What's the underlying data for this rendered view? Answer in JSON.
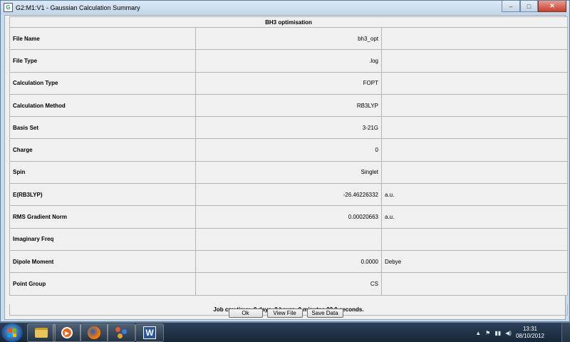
{
  "window": {
    "title": "G2:M1:V1 - Gaussian Calculation Summary",
    "icon_label": "G",
    "controls": {
      "minimize": "–",
      "maximize": "□",
      "close": "✕"
    }
  },
  "summary": {
    "header": "BH3 optimisation",
    "rows": [
      {
        "label": "File Name",
        "value": "bh3_opt",
        "unit": ""
      },
      {
        "label": "File Type",
        "value": ".log",
        "unit": ""
      },
      {
        "label": "Calculation Type",
        "value": "FOPT",
        "unit": ""
      },
      {
        "label": "Calculation Method",
        "value": "RB3LYP",
        "unit": ""
      },
      {
        "label": "Basis Set",
        "value": "3-21G",
        "unit": ""
      },
      {
        "label": "Charge",
        "value": "0",
        "unit": ""
      },
      {
        "label": "Spin",
        "value": "Singlet",
        "unit": ""
      },
      {
        "label": "E(RB3LYP)",
        "value": "-26.46226332",
        "unit": "a.u."
      },
      {
        "label": "RMS Gradient Norm",
        "value": "0.00020663",
        "unit": "a.u."
      },
      {
        "label": "Imaginary Freq",
        "value": "",
        "unit": ""
      },
      {
        "label": "Dipole Moment",
        "value": "0.0000",
        "unit": "Debye"
      },
      {
        "label": "Point Group",
        "value": "CS",
        "unit": ""
      }
    ],
    "cpu_time": "Job cpu time:  0 days  0 hours  0 minutes 23.0 seconds."
  },
  "buttons": {
    "ok": "Ok",
    "view_file": "View File",
    "save_data": "Save Data"
  },
  "taskbar": {
    "icons": [
      "folder-icon",
      "media-player-icon",
      "firefox-icon",
      "gaussview-icon",
      "word-icon"
    ],
    "word_letter": "W",
    "tray": {
      "arrow": "▲",
      "flag": "⚑",
      "signal": "▮▮",
      "volume": "◀)"
    },
    "time": "13:31",
    "date": "08/10/2012"
  }
}
